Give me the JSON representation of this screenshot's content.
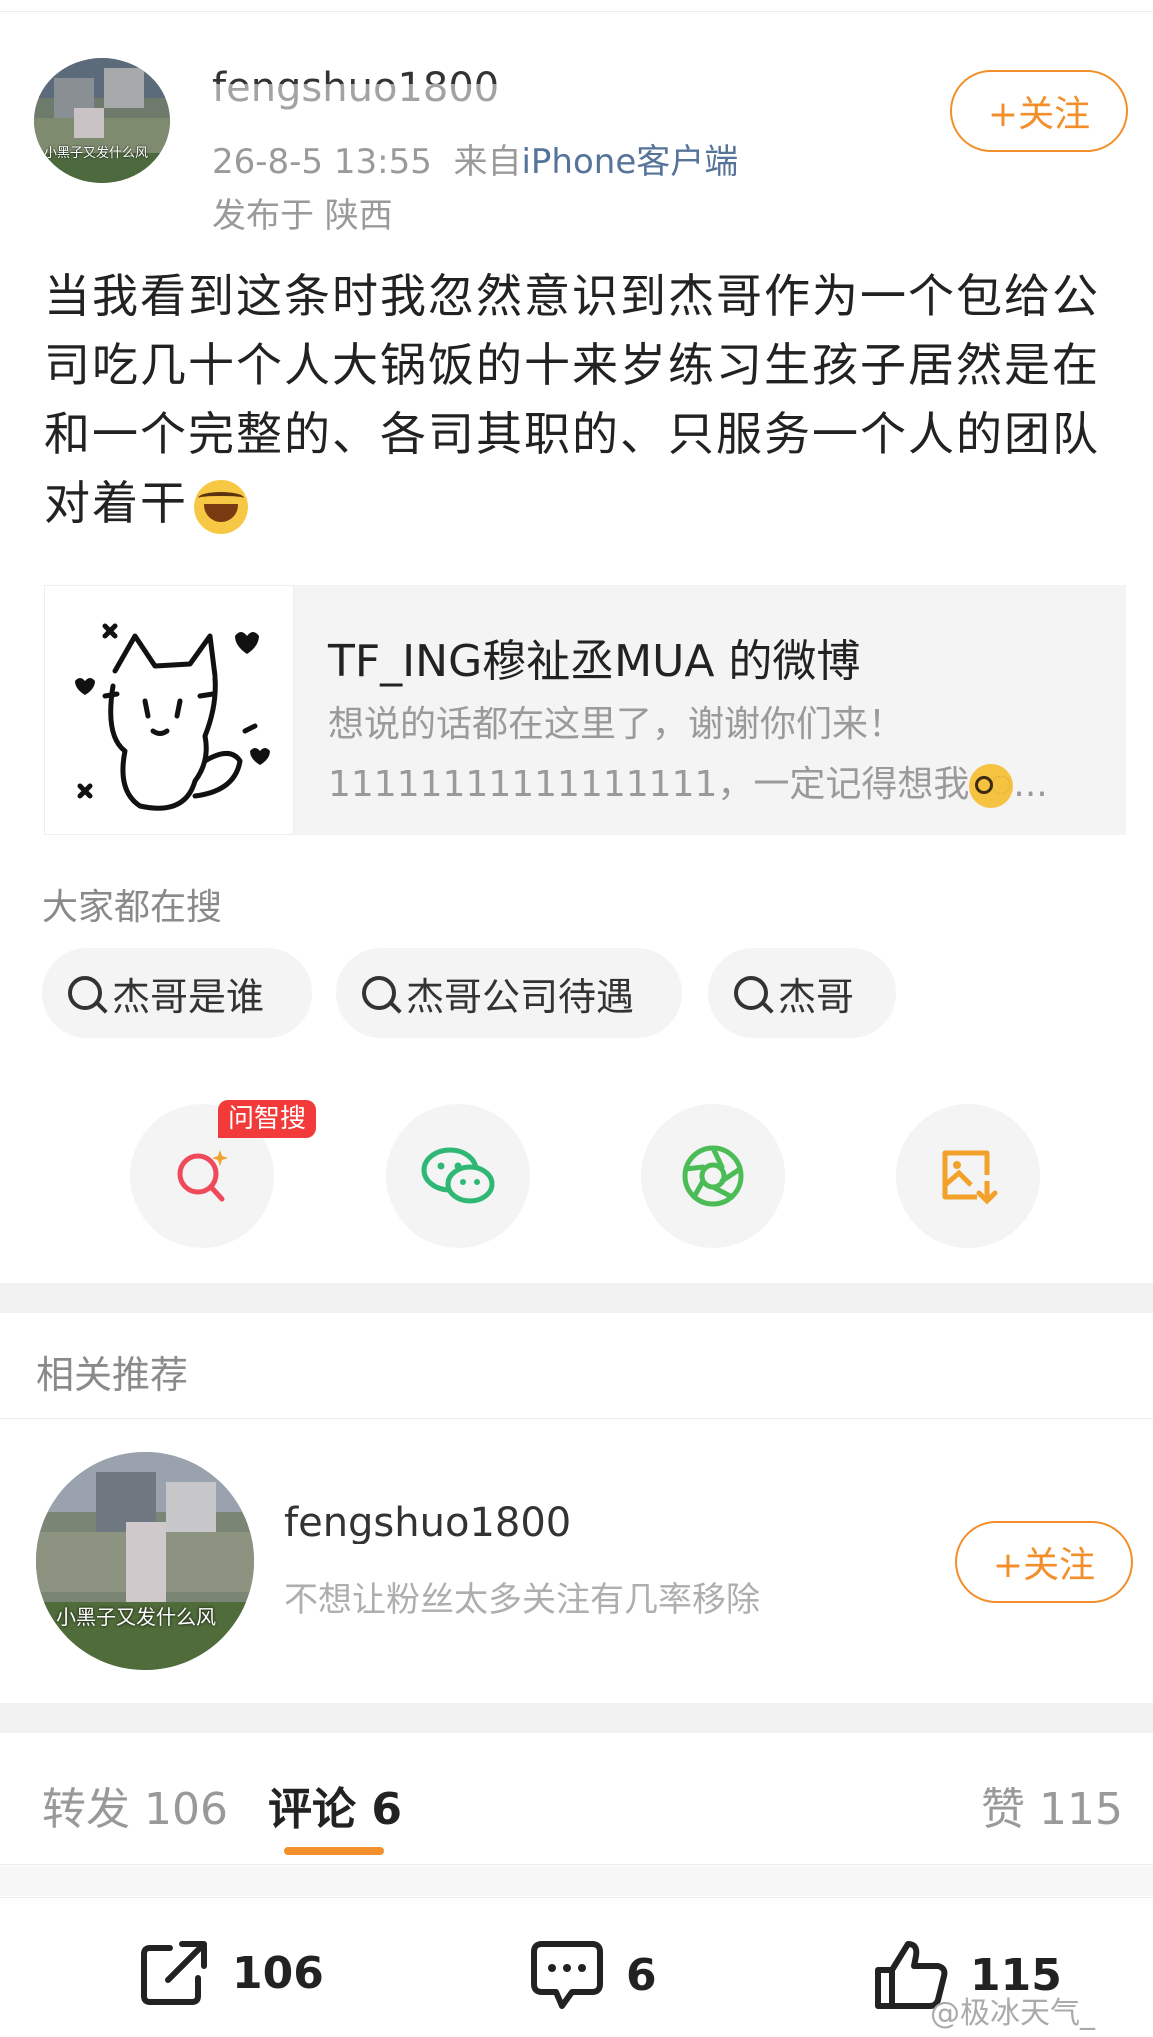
{
  "post": {
    "username": "fengshuo1800",
    "avatar_caption": "小黑子又发什么风",
    "time": "26-8-5 13:55",
    "from_label": "来自",
    "source": "iPhone客户端",
    "location": "发布于 陕西",
    "follow_label": "+关注",
    "text": "当我看到这条时我忽然意识到杰哥作为一个包给公司吃几十个人大锅饭的十来岁练习生孩子居然是在和一个完整的、各司其职的、只服务一个人的团队对着干",
    "emoji": "laugh-cry-emoji"
  },
  "link_card": {
    "title": "TF_ING穆祉丞MUA 的微博",
    "desc_line1": "想说的话都在这里了，谢谢你们来！",
    "desc_line2": "11111111111111111，一定记得想我",
    "ellipsis": "..."
  },
  "search": {
    "heading": "大家都在搜",
    "chips": [
      "杰哥是谁",
      "杰哥公司待遇",
      "杰哥"
    ]
  },
  "actions": {
    "badge": "问智搜",
    "icons": [
      "ai-search-icon",
      "wechat-icon",
      "moments-icon",
      "save-image-icon"
    ]
  },
  "related": {
    "heading": "相关推荐",
    "username": "fengshuo1800",
    "avatar_caption": "小黑子又发什么风",
    "desc": "不想让粉丝太多关注有几率移除",
    "follow_label": "+关注"
  },
  "tabs": {
    "repost": "转发 106",
    "comment": "评论 6",
    "like": "赞 115"
  },
  "toolbar": {
    "repost_count": "106",
    "comment_count": "6",
    "like_count": "115"
  },
  "watermark": "@极冰天气_",
  "colors": {
    "accent": "#f28f2b",
    "badge": "#f33a3a",
    "wechat": "#2fb875",
    "moments": "#4cbc56",
    "save": "#f2a12b",
    "ai_search": "#f04a5a"
  }
}
